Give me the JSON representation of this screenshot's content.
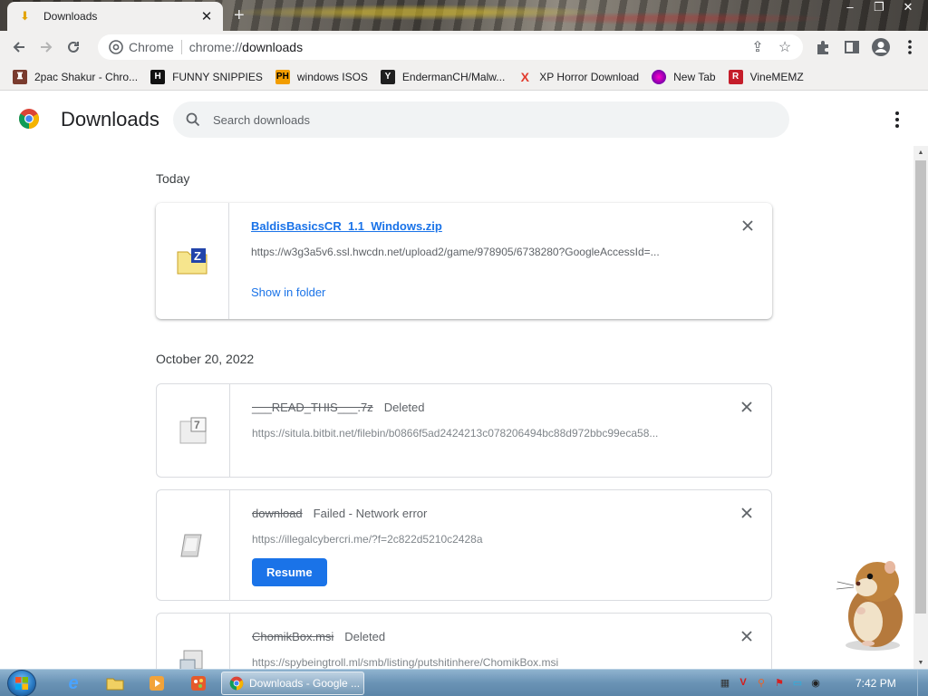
{
  "window": {
    "tab_title": "Downloads",
    "new_tab_label": "+",
    "controls": [
      "–",
      "❐",
      "✕"
    ]
  },
  "toolbar": {
    "chip_label": "Chrome",
    "url_prefix": "chrome://",
    "url_path": "downloads"
  },
  "bookmarks": [
    {
      "label": "2pac Shakur - Chro...",
      "icon": "2pac-favicon",
      "color": "#7a3b2e"
    },
    {
      "label": "FUNNY SNIPPIES",
      "icon": "H",
      "color": "#111111"
    },
    {
      "label": "windows ISOS",
      "icon": "PH",
      "color": "#f29d00"
    },
    {
      "label": "EndermanCH/Malw...",
      "icon": "Y",
      "color": "#1f1f1f"
    },
    {
      "label": "XP Horror Download",
      "icon": "X",
      "color": "#e23b2e"
    },
    {
      "label": "New Tab",
      "icon": "new-tab-favicon",
      "color": "#8a4ca0"
    },
    {
      "label": "VineMEMZ",
      "icon": "R",
      "color": "#c51d2a"
    }
  ],
  "page": {
    "title": "Downloads",
    "search_placeholder": "Search downloads"
  },
  "groups": [
    {
      "date": "Today",
      "items": [
        {
          "name": "BaldisBasicsCR_1.1_Windows.zip",
          "status": "",
          "url": "https://w3g3a5v6.ssl.hwcdn.net/upload2/game/978905/6738280?GoogleAccessId=...",
          "action": "Show in folder",
          "state": "complete",
          "icon": "zip-folder-icon"
        }
      ]
    },
    {
      "date": "October 20, 2022",
      "items": [
        {
          "name": "___READ_THIS___.7z",
          "status": "Deleted",
          "url": "https://situla.bitbit.net/filebin/b0866f5ad2424213c078206494bc88d972bbc99eca58...",
          "action": "",
          "state": "deleted",
          "icon": "7z-file-icon"
        },
        {
          "name": "download",
          "status": "Failed - Network error",
          "url": "https://illegalcybercri.me/?f=2c822d5210c2428a",
          "action": "Resume",
          "state": "failed",
          "icon": "generic-file-icon"
        },
        {
          "name": "ChomikBox.msi",
          "status": "Deleted",
          "url": "https://spybeingtroll.ml/smb/listing/putshitinhere/ChomikBox.msi",
          "action": "",
          "state": "deleted",
          "icon": "installer-icon"
        }
      ]
    }
  ],
  "taskbar": {
    "active_window": "Downloads - Google ...",
    "clock": "7:42 PM"
  }
}
